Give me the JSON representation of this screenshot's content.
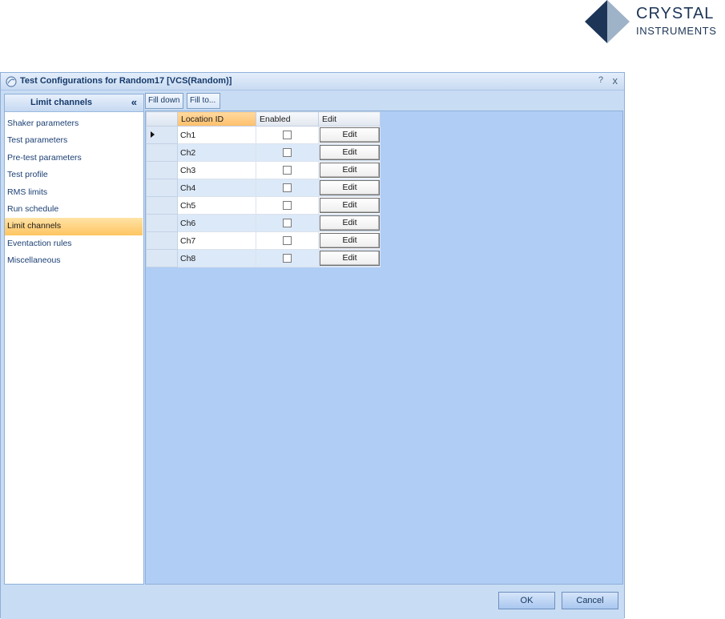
{
  "logo": {
    "word1": "CRYSTAL",
    "word2": "INSTRUMENTS",
    "color_dark": "#1d3557",
    "color_light": "#9fb3c8"
  },
  "window": {
    "title": "Test Configurations for Random17 [VCS(Random)]",
    "help_label": "?",
    "close_label": "x"
  },
  "left_panel": {
    "title": "Limit channels",
    "collapse_label": "«",
    "items": [
      {
        "label": "Shaker parameters"
      },
      {
        "label": "Test parameters"
      },
      {
        "label": "Pre-test parameters"
      },
      {
        "label": "Test profile"
      },
      {
        "label": "RMS limits"
      },
      {
        "label": "Run schedule"
      },
      {
        "label": "Limit channels"
      },
      {
        "label": "Eventaction rules"
      },
      {
        "label": "Miscellaneous"
      }
    ],
    "active_index": 6
  },
  "toolbar": {
    "fill_down": "Fill down",
    "fill_to": "Fill to..."
  },
  "grid": {
    "columns": [
      "Location ID",
      "Enabled",
      "Edit"
    ],
    "rows": [
      {
        "location": "Ch1",
        "enabled": false,
        "edit": "Edit"
      },
      {
        "location": "Ch2",
        "enabled": false,
        "edit": "Edit"
      },
      {
        "location": "Ch3",
        "enabled": false,
        "edit": "Edit"
      },
      {
        "location": "Ch4",
        "enabled": false,
        "edit": "Edit"
      },
      {
        "location": "Ch5",
        "enabled": false,
        "edit": "Edit"
      },
      {
        "location": "Ch6",
        "enabled": false,
        "edit": "Edit"
      },
      {
        "location": "Ch7",
        "enabled": false,
        "edit": "Edit"
      },
      {
        "location": "Ch8",
        "enabled": false,
        "edit": "Edit"
      }
    ],
    "current_row": 0
  },
  "footer": {
    "ok_label": "OK",
    "cancel_label": "Cancel"
  },
  "colors": {
    "active_item": "#ffc561",
    "grid_background": "#afcdf5",
    "window_background": "#c8dcf3"
  }
}
